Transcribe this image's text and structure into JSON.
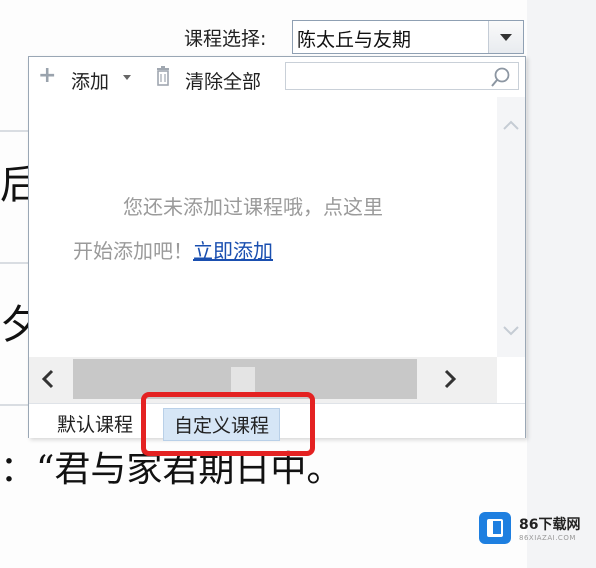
{
  "background_doc": {
    "char_1": "后",
    "char_2": "夕",
    "bottom_text": "：“君与家君期日中。"
  },
  "course_selector": {
    "label": "课程选择:",
    "selected": "陈太丘与友期"
  },
  "toolbar": {
    "add_label": "添加",
    "clear_label": "清除全部",
    "search_placeholder": ""
  },
  "empty_state": {
    "line1": "您还未添加过课程哦，点这里",
    "line2_prefix": "开始添加吧！",
    "link_label": "立即添加"
  },
  "tabs": [
    {
      "label": "默认课程",
      "active": false
    },
    {
      "label": "自定义课程",
      "active": true
    }
  ],
  "colors": {
    "highlight_border": "#e42222",
    "active_tab_bg": "#d6e6f6",
    "link": "#1a4fb0"
  },
  "watermark": {
    "brand": "86下载网",
    "sub": "86XIAZAI.COM"
  }
}
